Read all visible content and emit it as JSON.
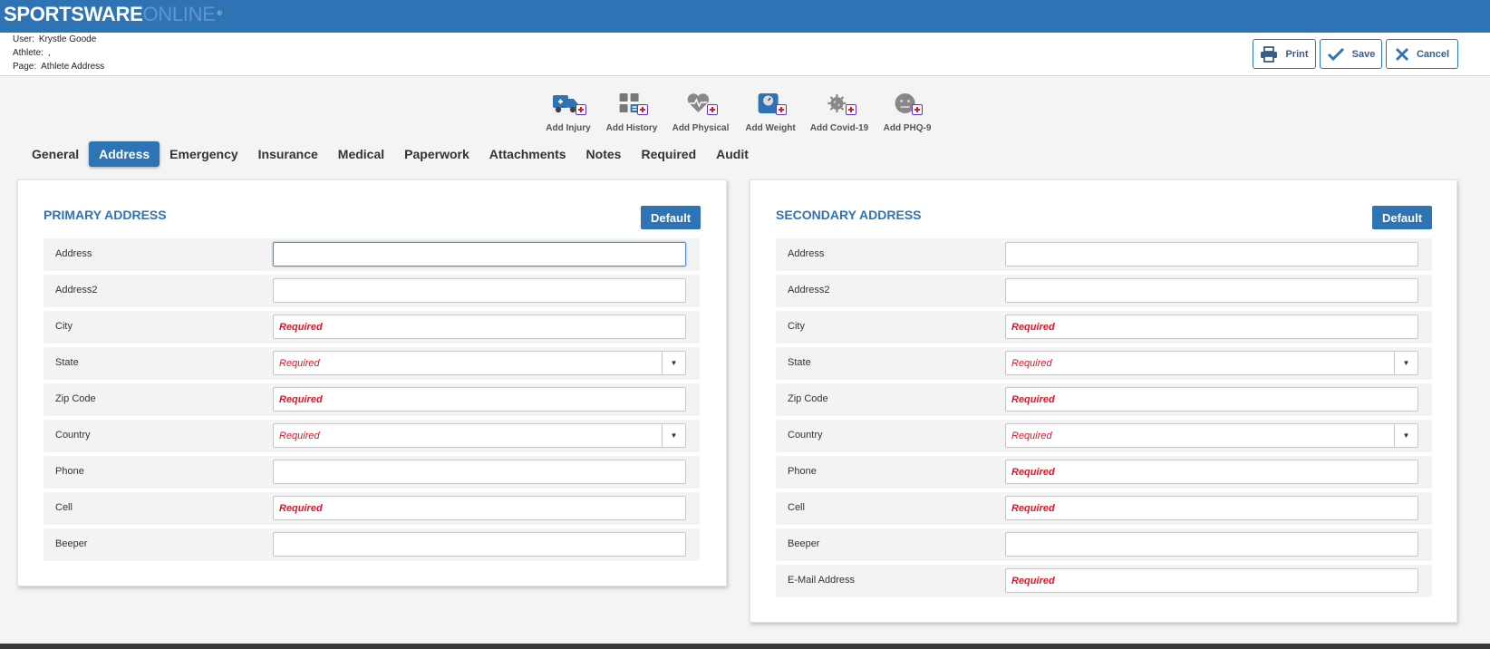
{
  "brand": {
    "bold": "SPORTSWARE",
    "light": "ONLINE",
    "tm": "®"
  },
  "info": {
    "user_label": "User:",
    "user_value": "Krystle Goode",
    "athlete_label": "Athlete:",
    "athlete_value": ",",
    "page_label": "Page:",
    "page_value": "Athlete Address"
  },
  "actions": {
    "print": "Print",
    "save": "Save",
    "cancel": "Cancel"
  },
  "quick_actions": [
    {
      "label": "Add Injury",
      "icon": "ambulance-icon"
    },
    {
      "label": "Add History",
      "icon": "history-icon"
    },
    {
      "label": "Add Physical",
      "icon": "heart-pulse-icon"
    },
    {
      "label": "Add Weight",
      "icon": "scale-icon"
    },
    {
      "label": "Add Covid-19",
      "icon": "virus-icon"
    },
    {
      "label": "Add PHQ-9",
      "icon": "face-icon"
    }
  ],
  "tabs": [
    "General",
    "Address",
    "Emergency",
    "Insurance",
    "Medical",
    "Paperwork",
    "Attachments",
    "Notes",
    "Required",
    "Audit"
  ],
  "active_tab": "Address",
  "required_text": "Required",
  "primary": {
    "title": "PRIMARY ADDRESS",
    "default_label": "Default",
    "fields": [
      {
        "label": "Address",
        "value": "",
        "placeholder": ""
      },
      {
        "label": "Address2",
        "value": "",
        "placeholder": ""
      },
      {
        "label": "City",
        "value": "",
        "placeholder": "Required"
      },
      {
        "label": "State",
        "selected": "Required"
      },
      {
        "label": "Zip Code",
        "value": "",
        "placeholder": "Required"
      },
      {
        "label": "Country",
        "selected": "Required"
      },
      {
        "label": "Phone",
        "value": "",
        "placeholder": ""
      },
      {
        "label": "Cell",
        "value": "",
        "placeholder": "Required"
      },
      {
        "label": "Beeper",
        "value": "",
        "placeholder": ""
      }
    ]
  },
  "secondary": {
    "title": "SECONDARY ADDRESS",
    "default_label": "Default",
    "fields": [
      {
        "label": "Address",
        "value": "",
        "placeholder": ""
      },
      {
        "label": "Address2",
        "value": "",
        "placeholder": ""
      },
      {
        "label": "City",
        "value": "",
        "placeholder": "Required"
      },
      {
        "label": "State",
        "selected": "Required"
      },
      {
        "label": "Zip Code",
        "value": "",
        "placeholder": "Required"
      },
      {
        "label": "Country",
        "selected": "Required"
      },
      {
        "label": "Phone",
        "value": "",
        "placeholder": "Required"
      },
      {
        "label": "Cell",
        "value": "",
        "placeholder": "Required"
      },
      {
        "label": "Beeper",
        "value": "",
        "placeholder": ""
      },
      {
        "label": "E-Mail Address",
        "value": "",
        "placeholder": "Required"
      }
    ]
  },
  "colors": {
    "brand_blue": "#2e74b5",
    "required_red": "#d8182a",
    "panel_bg": "#ffffff",
    "page_bg": "#f4f4f4"
  }
}
